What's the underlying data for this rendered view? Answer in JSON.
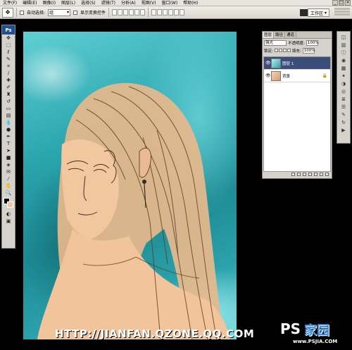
{
  "menubar": {
    "items": [
      "文件(F)",
      "编辑(E)",
      "图像(I)",
      "图层(L)",
      "选择(S)",
      "滤镜(T)",
      "分析(A)",
      "视图(V)",
      "窗口(W)",
      "帮助(H)"
    ],
    "window_controls": [
      "_",
      "□",
      "×"
    ]
  },
  "options_bar": {
    "auto_select_label": "自动选择:",
    "auto_select_value": "组",
    "show_transform_label": "显示变换控件",
    "workspace_label": "工作区"
  },
  "toolbox": {
    "logo": "Ps",
    "tools": [
      "move-tool",
      "marquee-tool",
      "lasso-tool",
      "quick-select-tool",
      "crop-tool",
      "slice-tool",
      "healing-tool",
      "brush-tool",
      "clone-stamp-tool",
      "history-brush-tool",
      "eraser-tool",
      "gradient-tool",
      "blur-tool",
      "dodge-tool",
      "pen-tool",
      "type-tool",
      "path-select-tool",
      "shape-tool",
      "3d-tool",
      "notes-tool",
      "eyedropper-tool",
      "hand-tool",
      "zoom-tool"
    ],
    "fg_color": "#000000",
    "bg_color": "#f2c69e"
  },
  "layers_panel": {
    "tabs": [
      "图层",
      "路径",
      "通道"
    ],
    "blend_mode": "强光",
    "opacity_label": "不透明度:",
    "opacity_value": "100%",
    "lock_label": "锁定:",
    "fill_label": "填充:",
    "fill_value": "100%",
    "layers": [
      {
        "name": "图层 1",
        "selected": true
      },
      {
        "name": "背景",
        "selected": false
      }
    ]
  },
  "dock": {
    "icons": [
      "navigator-icon",
      "histogram-icon",
      "info-icon",
      "color-icon",
      "swatches-icon",
      "styles-icon",
      "adjustments-icon",
      "masks-icon",
      "layers-icon",
      "channels-icon",
      "paths-icon",
      "history-icon",
      "actions-icon"
    ]
  },
  "watermark": {
    "url": "HTTP://JIANFAN.QZONE.QQ.COM",
    "badge_ps": "PS",
    "badge_han": "家园",
    "badge_site": "www.PSJIA.COM"
  },
  "colors": {
    "canvas_teal": "#2aa4ad",
    "skin": "#f2c69e",
    "selected_layer": "#3b4e7a"
  }
}
